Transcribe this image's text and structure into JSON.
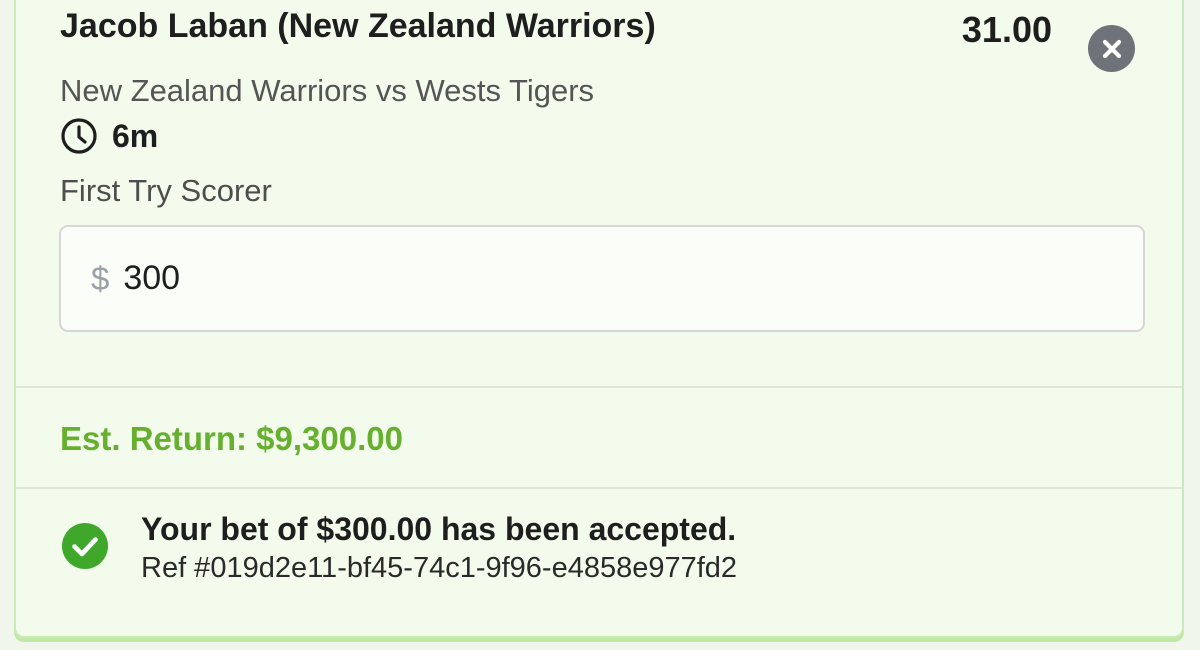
{
  "bet": {
    "runner": "Jacob Laban (New Zealand Warriors)",
    "odds": "31.00",
    "event": "New Zealand Warriors vs Wests Tigers",
    "time_to_start": "6m",
    "market": "First Try Scorer",
    "stake": {
      "currency_symbol": "$",
      "value": "300"
    },
    "est_return": "Est. Return: $9,300.00"
  },
  "confirmation": {
    "message": "Your bet of $300.00 has been accepted.",
    "reference": "Ref #019d2e11-bf45-74c1-9f96-e4858e977fd2"
  },
  "icons": {
    "close": "close-icon",
    "clock": "clock-icon",
    "success": "check-circle-icon"
  },
  "colors": {
    "accent_green": "#67b02f",
    "card_background": "#f2fbec",
    "close_button": "#6e7379",
    "success_icon": "#3fa82b"
  }
}
